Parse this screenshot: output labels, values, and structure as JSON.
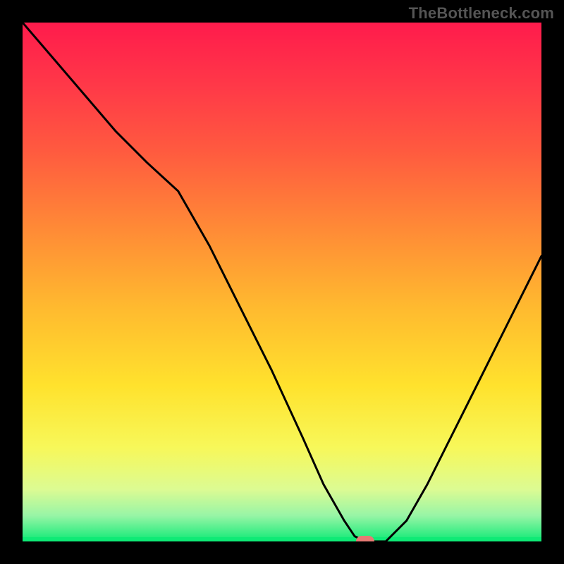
{
  "watermark": "TheBottleneck.com",
  "colors": {
    "frame": "#000000",
    "curve": "#000000",
    "axis_base": "#0fea76",
    "marker": "#e77a74",
    "gradient_stops": [
      {
        "offset": 0.0,
        "color": "#ff1b4c"
      },
      {
        "offset": 0.12,
        "color": "#ff3848"
      },
      {
        "offset": 0.25,
        "color": "#ff5b3f"
      },
      {
        "offset": 0.4,
        "color": "#ff8b36"
      },
      {
        "offset": 0.55,
        "color": "#ffba2f"
      },
      {
        "offset": 0.7,
        "color": "#ffe22d"
      },
      {
        "offset": 0.82,
        "color": "#f7f85a"
      },
      {
        "offset": 0.9,
        "color": "#dcfb93"
      },
      {
        "offset": 0.95,
        "color": "#98f5a6"
      },
      {
        "offset": 1.0,
        "color": "#0fea76"
      }
    ]
  },
  "chart_data": {
    "type": "line",
    "title": "",
    "xlabel": "",
    "ylabel": "",
    "xlim": [
      0,
      100
    ],
    "ylim": [
      0,
      100
    ],
    "grid": false,
    "legend": false,
    "series": [
      {
        "name": "bottleneck-curve",
        "x": [
          0,
          6,
          12,
          18,
          24,
          30,
          36,
          42,
          48,
          54,
          58,
          62,
          64,
          66,
          70,
          74,
          78,
          82,
          86,
          90,
          94,
          98,
          100
        ],
        "y": [
          100,
          93,
          86,
          79,
          73,
          67.5,
          57,
          45,
          33,
          20,
          11,
          4,
          1,
          0,
          0,
          4,
          11,
          19,
          27,
          35,
          43,
          51,
          55
        ]
      }
    ],
    "annotations": [
      {
        "type": "marker",
        "name": "optimal-point",
        "x": 66,
        "y": 0,
        "shape": "pill",
        "color": "#e77a74"
      }
    ]
  }
}
